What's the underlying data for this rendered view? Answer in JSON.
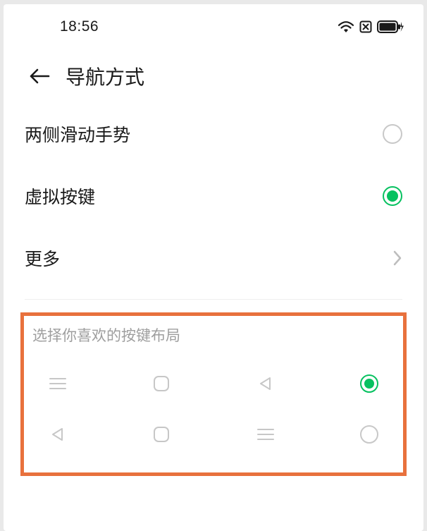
{
  "statusbar": {
    "time": "18:56"
  },
  "header": {
    "title": "导航方式"
  },
  "options": {
    "gesture_label": "两侧滑动手势",
    "virtual_keys_label": "虚拟按键",
    "more_label": "更多"
  },
  "layout_section": {
    "caption": "选择你喜欢的按键布局"
  },
  "colors": {
    "accent": "#07c160",
    "highlight_border": "#e8713d"
  }
}
